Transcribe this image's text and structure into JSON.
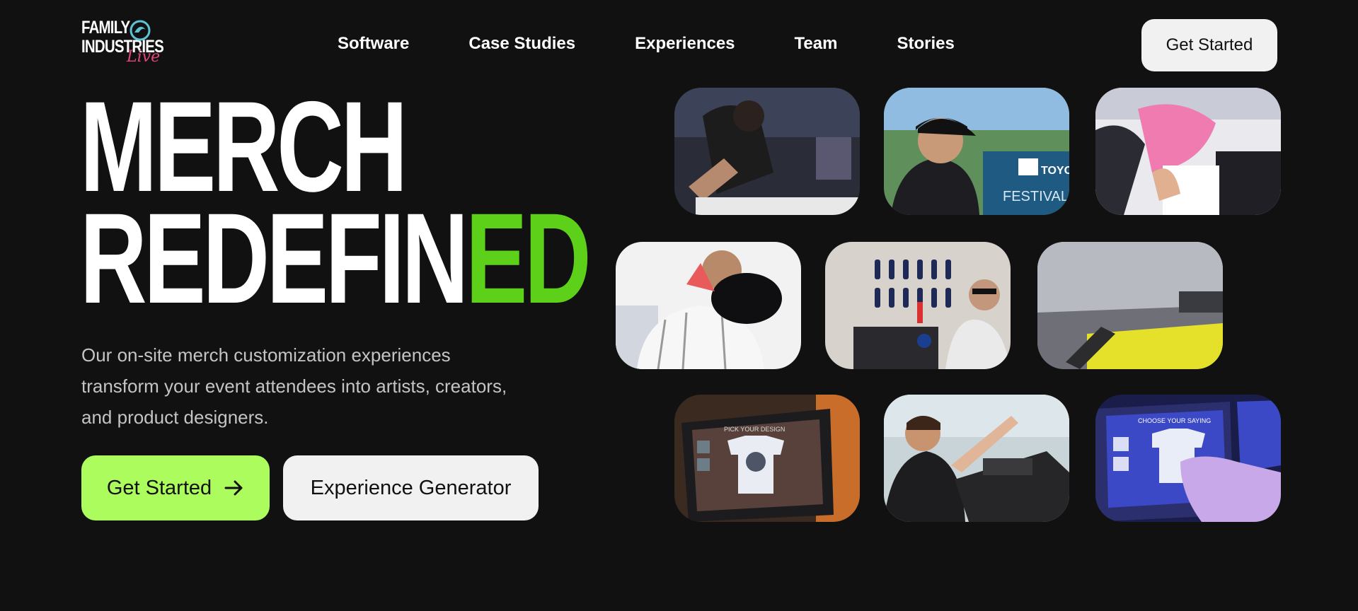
{
  "brand": {
    "logo_lines": [
      "FAMILY",
      "INDUSTRIES"
    ],
    "logo_script": "Live"
  },
  "nav": {
    "items": [
      "Software",
      "Case Studies",
      "Experiences",
      "Team",
      "Stories"
    ],
    "cta_label": "Get Started"
  },
  "hero": {
    "title_line1": "MERCH",
    "title_line2_main": "REDEFIN",
    "title_line2_accent": "ED",
    "subtitle": "Our on-site merch customization experiences transform your event attendees into artists, creators, and product designers.",
    "primary_button": "Get Started",
    "secondary_button": "Experience Generator"
  },
  "gallery": {
    "tile1_sign": "TOYOT",
    "tile1_sign2": "FESTIVAL",
    "screen1_text": "PICK YOUR DESIGN",
    "screen2_text": "CHOOSE YOUR SAYING"
  },
  "colors": {
    "background": "#111111",
    "accent_green": "#acfc5d",
    "title_green": "#5dd119",
    "logo_pink": "#e4447f"
  }
}
